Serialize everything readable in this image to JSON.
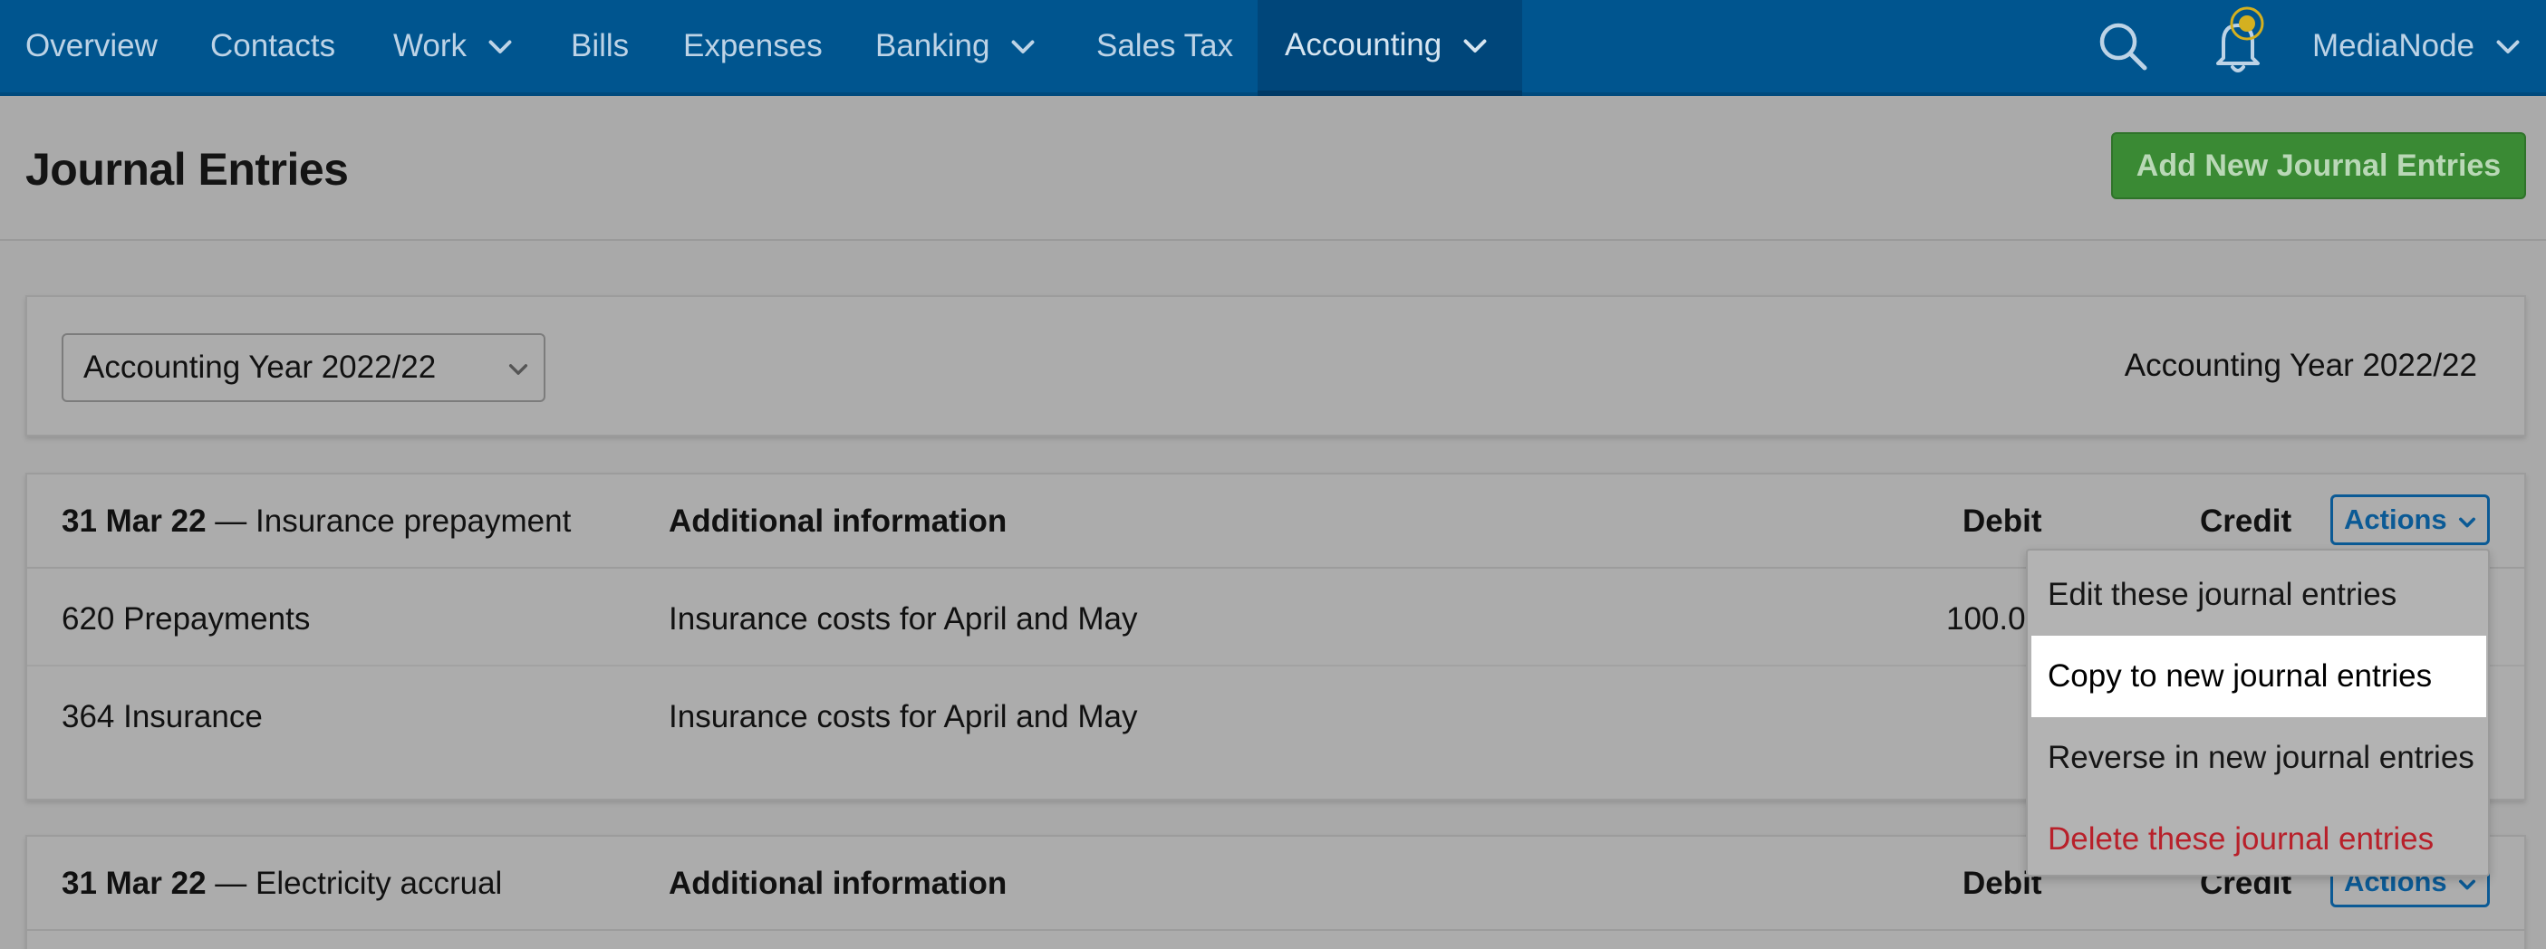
{
  "nav": {
    "items": [
      {
        "label": "Overview"
      },
      {
        "label": "Contacts"
      },
      {
        "label": "Work"
      },
      {
        "label": "Bills"
      },
      {
        "label": "Expenses"
      },
      {
        "label": "Banking"
      },
      {
        "label": "Sales Tax"
      },
      {
        "label": "Accounting"
      }
    ],
    "active": "Accounting",
    "account_name": "MediaNode",
    "notification_color": "#d4b020"
  },
  "header": {
    "title": "Journal Entries",
    "add_button": "Add New Journal Entries"
  },
  "filter": {
    "selected": "Accounting Year 2022/22",
    "label": "Accounting Year 2022/22"
  },
  "entries": [
    {
      "date": "31 Mar 22",
      "separator": "—",
      "description": "Insurance prepayment",
      "col_info": "Additional information",
      "col_debit": "Debit",
      "col_credit": "Credit",
      "actions_label": "Actions",
      "rows": [
        {
          "account": "620 Prepayments",
          "info": "Insurance costs for April and May",
          "debit": "100.0"
        },
        {
          "account": "364 Insurance",
          "info": "Insurance costs for April and May",
          "debit": ""
        }
      ]
    },
    {
      "date": "31 Mar 22",
      "separator": "—",
      "description": "Electricity accrual",
      "col_info": "Additional information",
      "col_debit": "Debit",
      "col_credit": "Credit",
      "actions_label": "Actions"
    }
  ],
  "actions_menu": {
    "items": [
      {
        "label": "Edit these journal entries"
      },
      {
        "label": "Copy to new journal entries"
      },
      {
        "label": "Reverse in new journal entries"
      },
      {
        "label": "Delete these journal entries"
      }
    ],
    "highlighted": "Copy to new journal entries",
    "danger_color": "#b8202a"
  },
  "colors": {
    "nav_bg": "#00558f",
    "primary_button": "#3a8a34",
    "link_blue": "#0b5a95"
  }
}
